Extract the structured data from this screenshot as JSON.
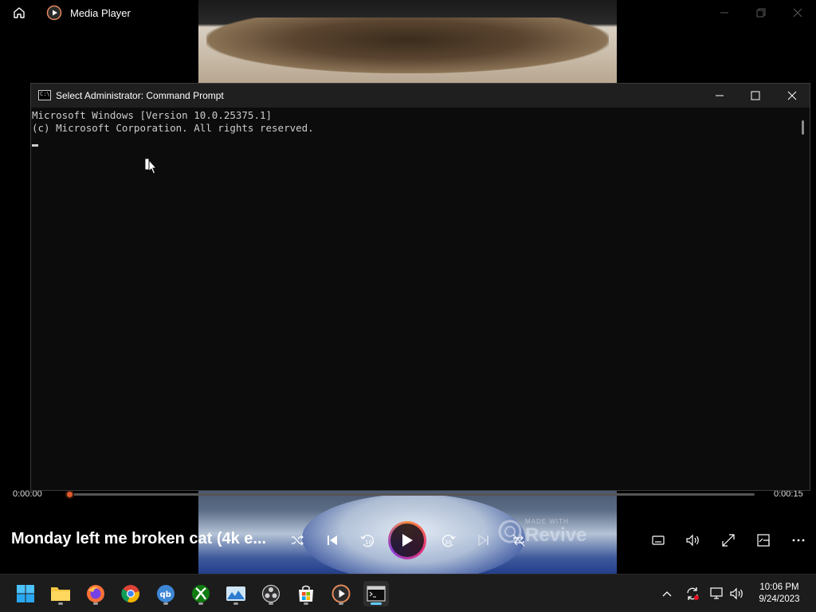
{
  "media_player": {
    "app_title": "Media Player",
    "current_time": "0:00:00",
    "total_time": "0:00:15",
    "progress_fraction": 0.0,
    "song_title": "Monday left me broken cat (4k e...",
    "watermark_small": "MADE WITH",
    "watermark_big": "Revive",
    "accent_color": "#e0592b"
  },
  "cmd": {
    "title": "Select Administrator: Command Prompt",
    "icon_text": "C:\\",
    "lines": [
      "Microsoft Windows [Version 10.0.25375.1]",
      "(c) Microsoft Corporation. All rights reserved."
    ]
  },
  "taskbar": {
    "apps": [
      "start-icon",
      "file-explorer-icon",
      "firefox-icon",
      "chrome-icon",
      "qbittorrent-icon",
      "xbox-icon",
      "photos-icon",
      "obs-icon",
      "microsoft-store-icon",
      "media-player-icon",
      "terminal-icon"
    ],
    "active_app": "terminal-icon"
  },
  "clock": {
    "time": "10:06 PM",
    "date": "9/24/2023"
  }
}
